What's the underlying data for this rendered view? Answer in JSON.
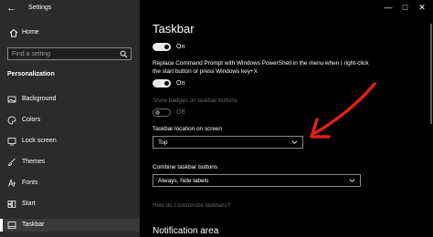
{
  "window": {
    "title": "Settings",
    "controls": [
      "—",
      "□",
      "✕"
    ]
  },
  "sidebar": {
    "home_label": "Home",
    "search_placeholder": "Find a setting",
    "section_title": "Personalization",
    "items": [
      {
        "label": "Background",
        "icon": "picture-icon"
      },
      {
        "label": "Colors",
        "icon": "palette-icon"
      },
      {
        "label": "Lock screen",
        "icon": "lock-screen-icon"
      },
      {
        "label": "Themes",
        "icon": "brush-icon"
      },
      {
        "label": "Fonts",
        "icon": "font-icon"
      },
      {
        "label": "Start",
        "icon": "start-icon"
      },
      {
        "label": "Taskbar",
        "icon": "taskbar-icon",
        "active": true
      }
    ]
  },
  "main": {
    "title": "Taskbar",
    "toggle1": {
      "state": "On"
    },
    "powershell_desc": "Replace Command Prompt with Windows PowerShell in the menu when I right-click the start button or press Windows key+X",
    "toggle2": {
      "state": "On"
    },
    "badges_label": "Show badges on taskbar buttons",
    "toggle3": {
      "state": "Off"
    },
    "location_label": "Taskbar location on screen",
    "location_value": "Top",
    "combine_label": "Combine taskbar buttons",
    "combine_value": "Always, hide labels",
    "customize_link": "How do I customize taskbars?",
    "notification_heading": "Notification area"
  },
  "colors": {
    "sidebar_bg": "#2b2b2b",
    "main_bg": "#000000",
    "arrow": "#e0201b",
    "dim_text": "#6a6a6a"
  }
}
